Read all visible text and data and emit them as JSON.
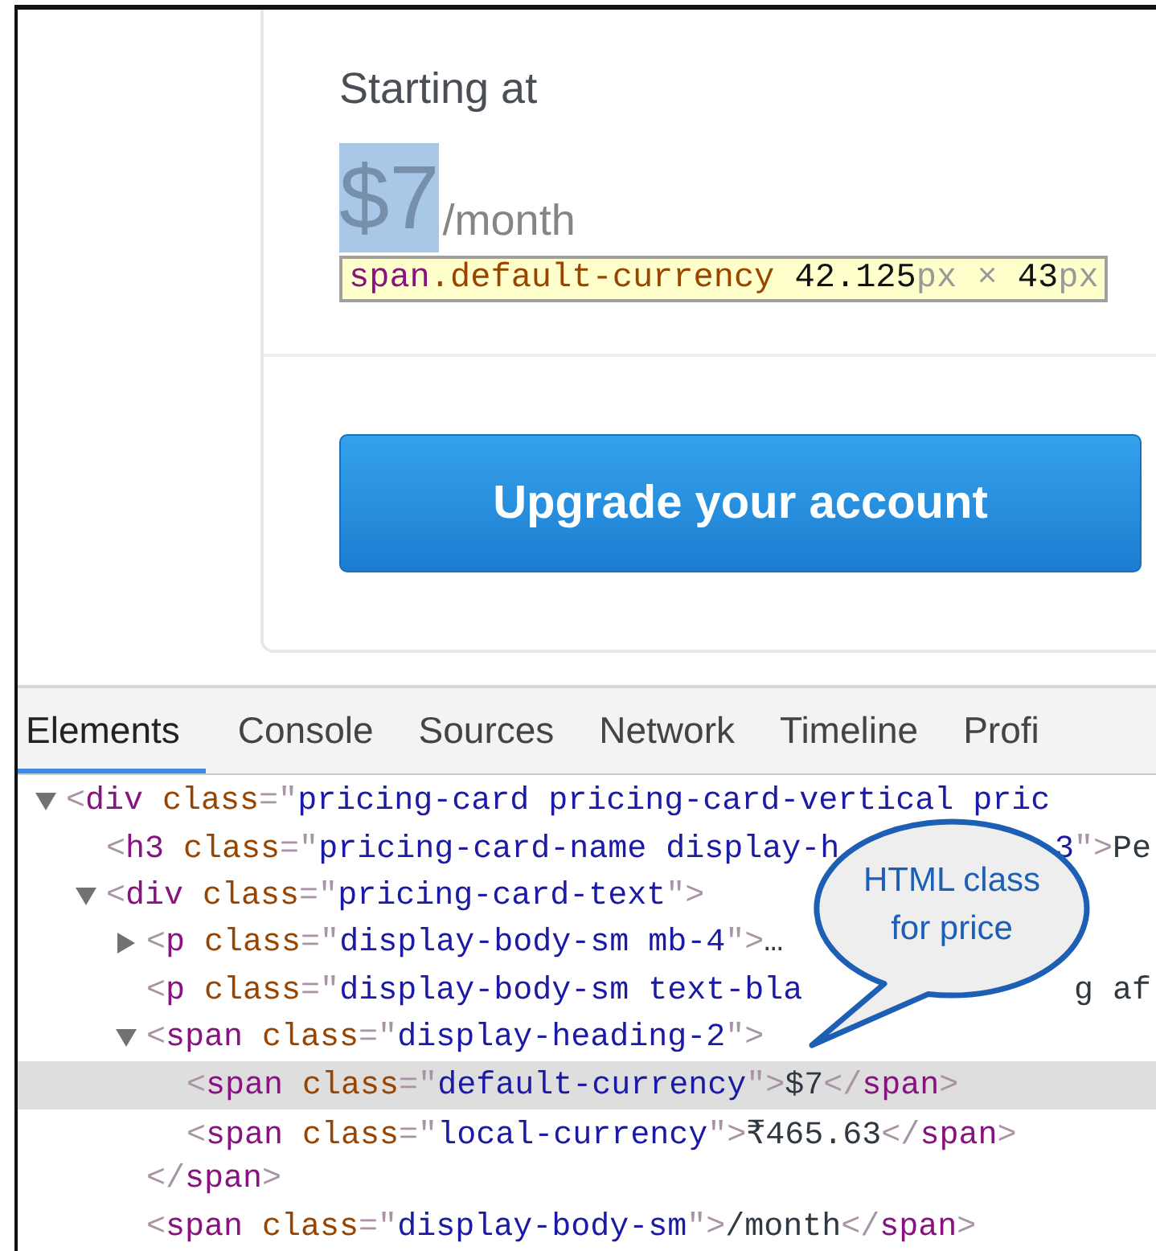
{
  "pricing_card": {
    "label": "Starting at",
    "price": "$7",
    "price_suffix": "/month",
    "inspect_tooltip": [
      {
        "kind": "tag",
        "text": "span"
      },
      {
        "kind": "attr",
        "text": ".default-currency"
      },
      {
        "kind": "num",
        "text": " 42.125"
      },
      {
        "kind": "unit",
        "text": "px"
      },
      {
        "kind": "unit",
        "text": " × "
      },
      {
        "kind": "num",
        "text": "43"
      },
      {
        "kind": "unit",
        "text": "px"
      }
    ],
    "button": "Upgrade your account"
  },
  "devtools": {
    "tabs": [
      {
        "label": "Elements",
        "selected": true
      },
      {
        "label": "Console",
        "selected": false
      },
      {
        "label": "Sources",
        "selected": false
      },
      {
        "label": "Network",
        "selected": false
      },
      {
        "label": "Timeline",
        "selected": false
      },
      {
        "label": "Profi",
        "selected": false
      }
    ],
    "tree": [
      {
        "expanded": true,
        "selected": false,
        "segments": [
          {
            "kind": "punct",
            "text": "<"
          },
          {
            "kind": "tag",
            "text": "div"
          },
          {
            "kind": "attr",
            "text": " class"
          },
          {
            "kind": "punct",
            "text": "=\""
          },
          {
            "kind": "value",
            "text": "pricing-card pricing-card-vertical pric"
          }
        ],
        "children": [
          {
            "selected": false,
            "segments": [
              {
                "kind": "punct",
                "text": "<"
              },
              {
                "kind": "tag",
                "text": "h3"
              },
              {
                "kind": "attr",
                "text": " class"
              },
              {
                "kind": "punct",
                "text": "=\""
              },
              {
                "kind": "value",
                "text": "pricing-card-name display-h"
              }
            ],
            "tail": [
              {
                "kind": "value",
                "text": "3"
              },
              {
                "kind": "punct",
                "text": "\">"
              },
              {
                "kind": "text",
                "text": "Pe"
              }
            ]
          },
          {
            "expanded": true,
            "selected": false,
            "segments": [
              {
                "kind": "punct",
                "text": "<"
              },
              {
                "kind": "tag",
                "text": "div"
              },
              {
                "kind": "attr",
                "text": " class"
              },
              {
                "kind": "punct",
                "text": "=\""
              },
              {
                "kind": "value",
                "text": "pricing-card-text"
              },
              {
                "kind": "punct",
                "text": "\">"
              }
            ],
            "children": [
              {
                "expanded": false,
                "selected": false,
                "segments": [
                  {
                    "kind": "punct",
                    "text": "<"
                  },
                  {
                    "kind": "tag",
                    "text": "p"
                  },
                  {
                    "kind": "attr",
                    "text": " class"
                  },
                  {
                    "kind": "punct",
                    "text": "=\""
                  },
                  {
                    "kind": "value",
                    "text": "display-body-sm mb-4"
                  },
                  {
                    "kind": "punct",
                    "text": "\">"
                  },
                  {
                    "kind": "text",
                    "text": "…"
                  }
                ]
              },
              {
                "selected": false,
                "segments": [
                  {
                    "kind": "punct",
                    "text": "<"
                  },
                  {
                    "kind": "tag",
                    "text": "p"
                  },
                  {
                    "kind": "attr",
                    "text": " class"
                  },
                  {
                    "kind": "punct",
                    "text": "=\""
                  },
                  {
                    "kind": "value",
                    "text": "display-body-sm text-bla"
                  }
                ],
                "tail": [
                  {
                    "kind": "text",
                    "text": "g af"
                  }
                ]
              },
              {
                "expanded": true,
                "selected": false,
                "segments": [
                  {
                    "kind": "punct",
                    "text": "<"
                  },
                  {
                    "kind": "tag",
                    "text": "span"
                  },
                  {
                    "kind": "attr",
                    "text": " class"
                  },
                  {
                    "kind": "punct",
                    "text": "=\""
                  },
                  {
                    "kind": "value",
                    "text": "display-heading-2"
                  },
                  {
                    "kind": "punct",
                    "text": "\">"
                  }
                ],
                "children": [
                  {
                    "selected": true,
                    "segments": [
                      {
                        "kind": "punct",
                        "text": "<"
                      },
                      {
                        "kind": "tag",
                        "text": "span"
                      },
                      {
                        "kind": "attr",
                        "text": " class"
                      },
                      {
                        "kind": "punct",
                        "text": "=\""
                      },
                      {
                        "kind": "value",
                        "text": "default-currency"
                      },
                      {
                        "kind": "punct",
                        "text": "\">"
                      },
                      {
                        "kind": "text",
                        "text": "$7"
                      },
                      {
                        "kind": "punct",
                        "text": "</"
                      },
                      {
                        "kind": "tag",
                        "text": "span"
                      },
                      {
                        "kind": "punct",
                        "text": ">"
                      }
                    ]
                  },
                  {
                    "selected": false,
                    "segments": [
                      {
                        "kind": "punct",
                        "text": "<"
                      },
                      {
                        "kind": "tag",
                        "text": "span"
                      },
                      {
                        "kind": "attr",
                        "text": " class"
                      },
                      {
                        "kind": "punct",
                        "text": "=\""
                      },
                      {
                        "kind": "value",
                        "text": "local-currency"
                      },
                      {
                        "kind": "punct",
                        "text": "\">"
                      },
                      {
                        "kind": "text",
                        "text": "₹465.63"
                      },
                      {
                        "kind": "punct",
                        "text": "</"
                      },
                      {
                        "kind": "tag",
                        "text": "span"
                      },
                      {
                        "kind": "punct",
                        "text": ">"
                      }
                    ]
                  }
                ]
              },
              {
                "selected": false,
                "segments": [
                  {
                    "kind": "punct",
                    "text": "</"
                  },
                  {
                    "kind": "tag",
                    "text": "span"
                  },
                  {
                    "kind": "punct",
                    "text": ">"
                  }
                ]
              },
              {
                "selected": false,
                "segments": [
                  {
                    "kind": "punct",
                    "text": "<"
                  },
                  {
                    "kind": "tag",
                    "text": "span"
                  },
                  {
                    "kind": "attr",
                    "text": " class"
                  },
                  {
                    "kind": "punct",
                    "text": "=\""
                  },
                  {
                    "kind": "value",
                    "text": "display-body-sm"
                  },
                  {
                    "kind": "punct",
                    "text": "\">"
                  },
                  {
                    "kind": "text",
                    "text": "/month"
                  },
                  {
                    "kind": "punct",
                    "text": "</"
                  },
                  {
                    "kind": "tag",
                    "text": "span"
                  },
                  {
                    "kind": "punct",
                    "text": ">"
                  }
                ]
              }
            ]
          }
        ]
      }
    ],
    "callout": "HTML class for price"
  }
}
